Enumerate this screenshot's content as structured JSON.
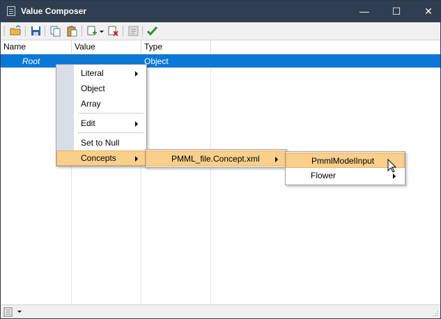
{
  "window": {
    "title": "Value Composer",
    "minimize_glyph": "—",
    "maximize_glyph": "☐",
    "close_glyph": "✕"
  },
  "toolbar": {
    "icons": [
      "open-icon",
      "save-icon",
      "copy-icon",
      "paste-icon",
      "add-item-icon",
      "delete-item-icon",
      "properties-icon",
      "apply-check-icon"
    ]
  },
  "columns": [
    "Name",
    "Value",
    "Type"
  ],
  "rows": [
    {
      "name": "Root",
      "value": "",
      "type": "Object",
      "selected": true
    }
  ],
  "context_menu": {
    "items": [
      {
        "label": "Literal",
        "submenu": true
      },
      {
        "label": "Object",
        "submenu": false
      },
      {
        "label": "Array",
        "submenu": false
      },
      {
        "label": "Edit",
        "submenu": true
      },
      {
        "label": "Set to Null",
        "submenu": false
      },
      {
        "label": "Concepts",
        "submenu": true,
        "highlighted": true
      }
    ]
  },
  "concepts_menu": {
    "items": [
      {
        "label": "PMML_file.Concept.xml",
        "submenu": true,
        "highlighted": true
      }
    ]
  },
  "concept_file_menu": {
    "items": [
      {
        "label": "PmmlModelInput",
        "submenu": false,
        "highlighted": true
      },
      {
        "label": "Flower",
        "submenu": true
      }
    ]
  },
  "colors": {
    "titlebar": "#2f3e50",
    "selection": "#0a78d7",
    "menu_highlight": "#f8cf8b",
    "menu_gutter": "#d9dde8"
  }
}
